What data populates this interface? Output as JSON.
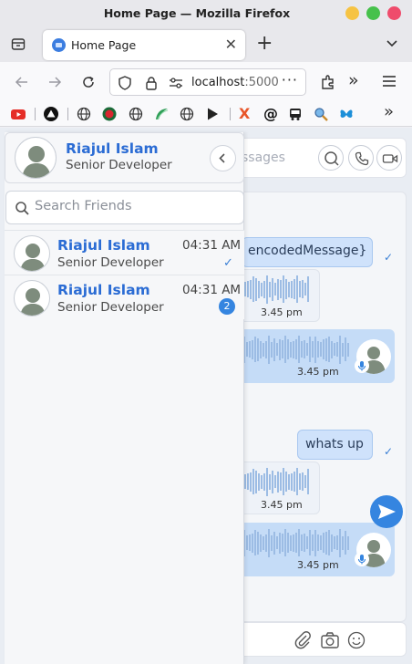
{
  "window": {
    "title": "Home Page — Mozilla Firefox"
  },
  "tab": {
    "label": "Home Page"
  },
  "urlbar": {
    "host": "localhost",
    "port": ":5000"
  },
  "profile": {
    "name": "Riajul Islam",
    "role": "Senior Developer"
  },
  "search": {
    "placeholder": "Search Friends"
  },
  "friends": [
    {
      "name": "Riajul Islam",
      "role": "Senior Developer",
      "time": "04:31 AM",
      "status": "read"
    },
    {
      "name": "Riajul Islam",
      "role": "Senior Developer",
      "time": "04:31 AM",
      "unread": "2"
    }
  ],
  "chat": {
    "search_placeholder": "ssages",
    "messages": [
      {
        "text": "encodedMessage}"
      },
      {
        "time": "3.45 pm"
      },
      {
        "time": "3.45 pm"
      },
      {
        "text": "whats up"
      },
      {
        "time": "3.45 pm"
      },
      {
        "time": "3.45 pm"
      }
    ]
  },
  "colors": {
    "accent": "#3585e0",
    "name_blue": "#2b6cd4",
    "bubble": "#cfe2fb"
  }
}
